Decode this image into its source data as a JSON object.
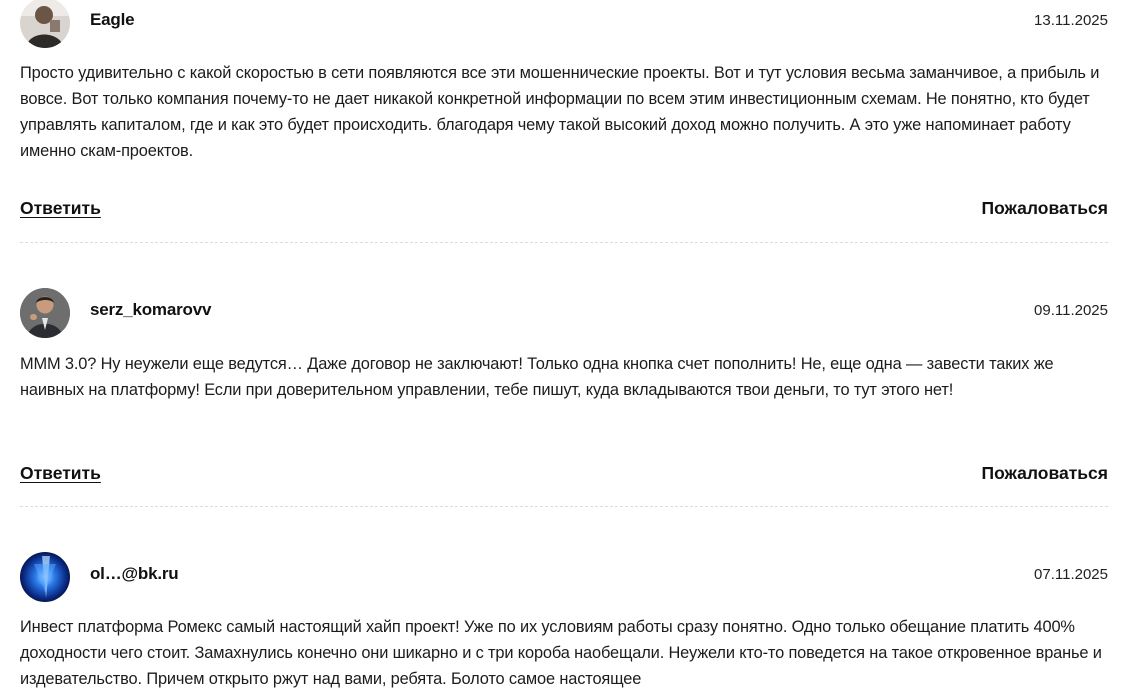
{
  "comments": [
    {
      "author": "Eagle",
      "date": "13.11.2025",
      "text": "Просто удивительно с какой скоростью в сети появляются все эти мошеннические проекты. Вот и тут условия весьма заманчивое, а прибыль и вовсе. Вот только компания почему-то не дает никакой конкретной информации по всем этим инвестиционным схемам. Не понятно, кто будет управлять капиталом, где и как это будет происходить. благодаря чему такой высокий доход можно получить. А это уже напоминает работу именно скам-проектов.",
      "reply_label": "Ответить",
      "report_label": "Пожаловаться"
    },
    {
      "author": "serz_komarovv",
      "date": "09.11.2025",
      "text": "МММ 3.0? Ну неужели еще ведутся… Даже договор не заключают! Только одна кнопка счет пополнить! Не, еще одна — завести таких же наивных на платформу! Если при доверительном управлении, тебе пишут, куда вкладываются твои деньги, то тут этого нет!",
      "reply_label": "Ответить",
      "report_label": "Пожаловаться"
    },
    {
      "author": "ol…@bk.ru",
      "date": "07.11.2025",
      "text": "Инвест платформа Ромекс самый настоящий хайп проект! Уже по их условиям работы сразу понятно. Одно только обещание платить 400% доходности чего стоит. Замахнулись конечно они шикарно и с три короба наобещали. Неужели кто-то поведется на такое откровенное вранье и издевательство. Причем открыто ржут над вами, ребята. Болото самое настоящее"
    }
  ],
  "icons": {
    "avatar_1": "avatar-photo-icon",
    "avatar_2": "avatar-photo-icon",
    "avatar_3": "avatar-blue-abstract-icon"
  },
  "colors": {
    "text": "#1a1a1a",
    "divider": "#dcdcdc",
    "background": "#ffffff"
  }
}
